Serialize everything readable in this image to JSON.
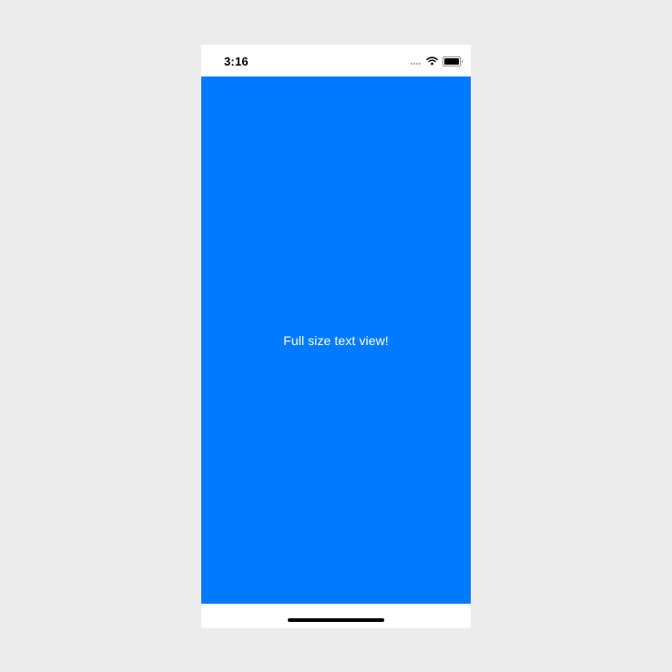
{
  "status_bar": {
    "time": "3:16",
    "icons": [
      "cellular-signal-icon",
      "wifi-icon",
      "battery-icon"
    ]
  },
  "main": {
    "text": "Full size text view!",
    "background_color": "#007aff",
    "text_color": "#ffffff"
  },
  "home_indicator": {
    "icon": "home-indicator"
  }
}
